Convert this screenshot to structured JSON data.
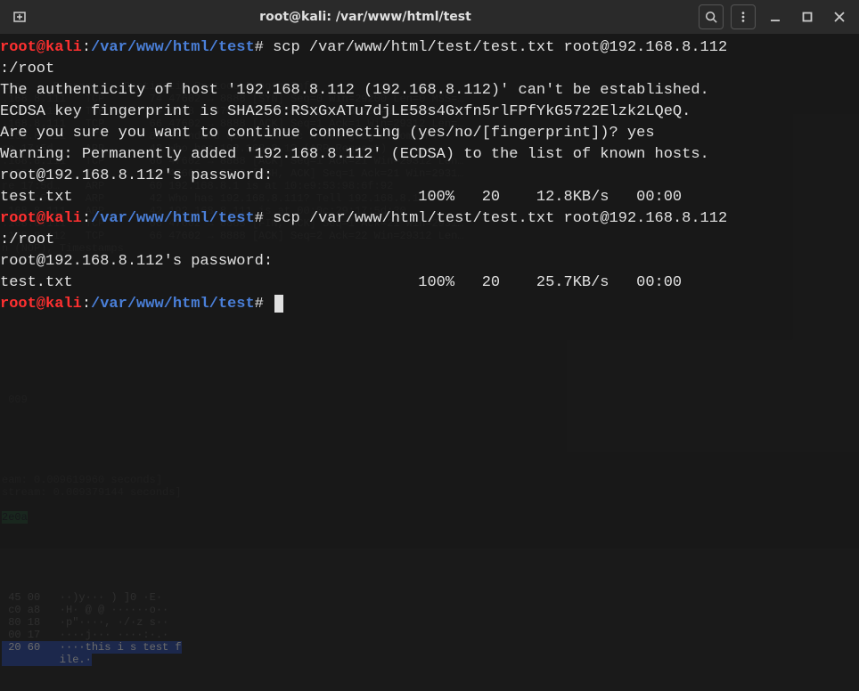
{
  "window": {
    "title": "root@kali: /var/www/html/test"
  },
  "prompt": {
    "user_host": "root@kali",
    "colon": ":",
    "path": "/var/www/html/test",
    "hash": "#"
  },
  "session": {
    "cmd1_a": " scp /var/www/html/test/test.txt root@192.168.8.112",
    "cmd1_b": ":/root",
    "auth_line": "The authenticity of host '192.168.8.112 (192.168.8.112)' can't be established.",
    "ecdsa_line": "ECDSA key fingerprint is SHA256:RSxGxATu7djLE58s4Gxfn5rlFPfYkG5722Elzk2LQeQ.",
    "confirm_line": "Are you sure you want to continue connecting (yes/no/[fingerprint])? yes",
    "warn_line": "Warning: Permanently added '192.168.8.112' (ECDSA) to the list of known hosts.",
    "pw1": "root@192.168.8.112's password:",
    "xfer1": "test.txt                                      100%   20    12.8KB/s   00:00",
    "cmd2_a": " scp /var/www/html/test/test.txt root@192.168.8.112",
    "cmd2_b": ":/root",
    "pw2": "root@192.168.8.112's password:",
    "xfer2": "test.txt                                      100%   20    25.7KB/s   00:00"
  },
  "ghost": {
    "t1": "ime     Source     Destinatio Protoco Length Info",
    "t2": ".168.8.111   TCP       74 47602 → 8888 [SYN] Seq=0 Win=29200 Len=0 MSS=…",
    "t3": ".168.8.112   TCP       74 8888 → 47692 [SYN, ACK] Seq=0 Ack=1 Win=65160 …",
    "t4": ".168.8.111   TCP       66 47602 → 8888 [ACK] Seq=1 Ack=1 Win=29312 Len=…",
    "t5": ".168.8.111   HT…       86 Standard query 0x876c A www.google.com OPT",
    "t6": "re 17:5d…    ARP       42 Who has 192.168.8.1? (ARP Request)",
    "t7": ".168.8.111   TCP       66 47602 → 8888 [ACK] Seq=1 Ack=21 Win=29312 Len…",
    "t8": ".168.8.111   TCP       87 47602 → 8888 [PSH, ACK] Seq=1 Ack=21 Win=2931…",
    "t9": "re 17:5d…    ARP       60 192.168.8.1 is at 10:e9:53:98:6f:92",
    "t10": "re 17:5d…    ARP       42 Who has 192.168.8.111? Tell 192.168.8.1",
    "t11": ".168.8.111   ARP       42 192.168.8.111 is at 00:0c:29:17:5d:30",
    "t12": ".168.8.111   TCP       66 47602 → 8888 [FIN, ACK] Seq=1 Ack=21 Win=2931…",
    "t13": ".168.8.112   TCP       66 47602 → 8888 [ACK] Seq=2 Ack=22 Win=29312 Len…",
    "t14": "n (NOP), Timestamps",
    "s2a": " 009",
    "s3a": "eam: 0.009619960 seconds]",
    "s3b": "stream: 0.009379144 seconds]",
    "s3c": "2e0a",
    "h1": " 45 00   ··)y··· ) ]0 ·E·",
    "h2": " c0 a8   ·H· @ @ ······o··",
    "h3": " 80 18   ·p\"····, ·/·z s··",
    "h4": " 00 17   ····j··· ····:·.·",
    "h5": " 20 60   ····this i s test f",
    "h6": "         ile.·"
  }
}
